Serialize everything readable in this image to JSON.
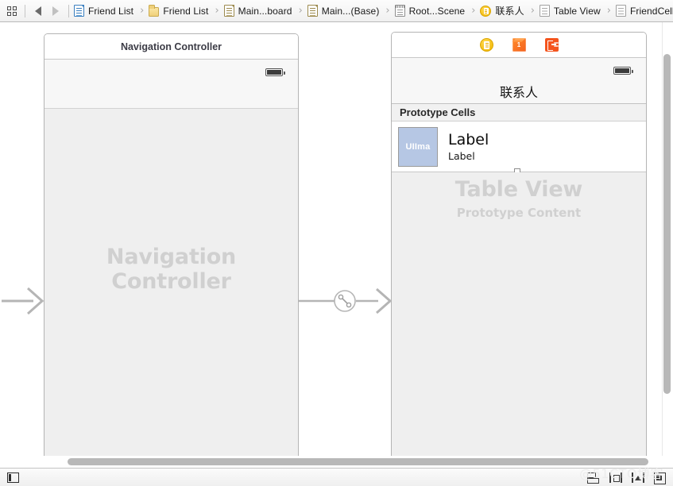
{
  "jumpbar": {
    "grid_button": "related-items",
    "back_label": "Back",
    "forward_label": "Forward",
    "crumbs": [
      {
        "label": "Friend List",
        "icon": "project-document-icon"
      },
      {
        "label": "Friend List",
        "icon": "folder-icon"
      },
      {
        "label": "Main...board",
        "icon": "storyboard-document-icon"
      },
      {
        "label": "Main...(Base)",
        "icon": "storyboard-document-icon"
      },
      {
        "label": "Root...Scene",
        "icon": "scene-icon"
      },
      {
        "label": "联系人",
        "icon": "view-controller-icon"
      },
      {
        "label": "Table View",
        "icon": "table-view-icon"
      },
      {
        "label": "FriendCellIdentifier",
        "icon": "table-view-cell-icon"
      }
    ],
    "separator": "›"
  },
  "canvas": {
    "nav_scene": {
      "titlebar": "Navigation Controller",
      "placeholder": "Navigation Controller",
      "battery_icon": "battery-icon"
    },
    "table_scene": {
      "toolbar_icons": [
        {
          "name": "view-controller-icon",
          "tooltip": "View Controller"
        },
        {
          "name": "first-responder-icon",
          "tooltip": "First Responder"
        },
        {
          "name": "exit-icon",
          "tooltip": "Exit"
        }
      ],
      "navbar_title": "联系人",
      "section_header": "Prototype Cells",
      "cell": {
        "image_label": "UIIma",
        "title": "Label",
        "subtitle": "Label",
        "image_bg_color": "#b6c7e4"
      },
      "placeholder_title": "Table View",
      "placeholder_subtitle": "Prototype Content",
      "battery_icon": "battery-icon"
    },
    "segues": {
      "entry_point": "storyboard-entry-point-arrow",
      "relationship": "relationship-segue-root-view-controller"
    }
  },
  "bottombar": {
    "outline_toggle": "document-outline-toggle",
    "autolayout_buttons": [
      {
        "name": "align-button",
        "label": "Align"
      },
      {
        "name": "pin-button",
        "label": "Pin"
      },
      {
        "name": "resolve-button",
        "label": "Resolve Auto Layout Issues"
      },
      {
        "name": "update-button",
        "label": "Resizing Behavior"
      }
    ]
  },
  "watermark": "@51CTO博客"
}
